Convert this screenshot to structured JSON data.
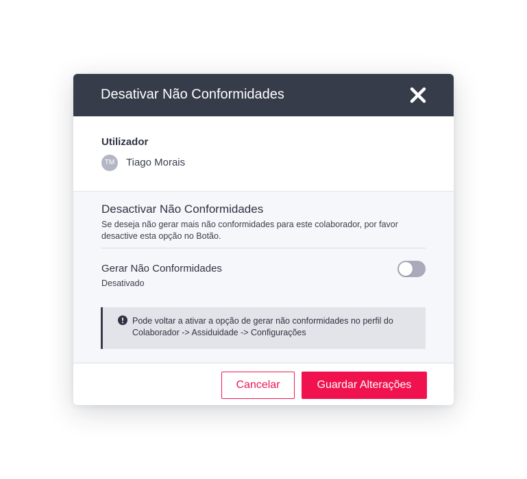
{
  "modal": {
    "title": "Desativar Não Conformidades",
    "close_icon": "close-icon"
  },
  "user_section": {
    "label": "Utilizador",
    "avatar_initials": "TM",
    "user_name": "Tiago Morais"
  },
  "settings": {
    "title": "Desactivar Não Conformidades",
    "description": "Se deseja não gerar mais não conformidades para este colaborador, por favor desactive esta opção no Botão.",
    "toggle": {
      "label": "Gerar Não Conformidades",
      "status": "Desativado",
      "enabled": false
    },
    "info": {
      "icon": "exclamation-circle-icon",
      "text": "Pode voltar a ativar a opção de gerar não conformidades no perfil do Colaborador -> Assiduidade -> Configurações"
    }
  },
  "footer": {
    "cancel_label": "Cancelar",
    "save_label": "Guardar Alterações"
  },
  "colors": {
    "header_bg": "#373c4a",
    "accent": "#f0124f",
    "toggle_off": "#a9abba",
    "info_bg": "#e2e4e9",
    "settings_bg": "#f6f7fb"
  }
}
